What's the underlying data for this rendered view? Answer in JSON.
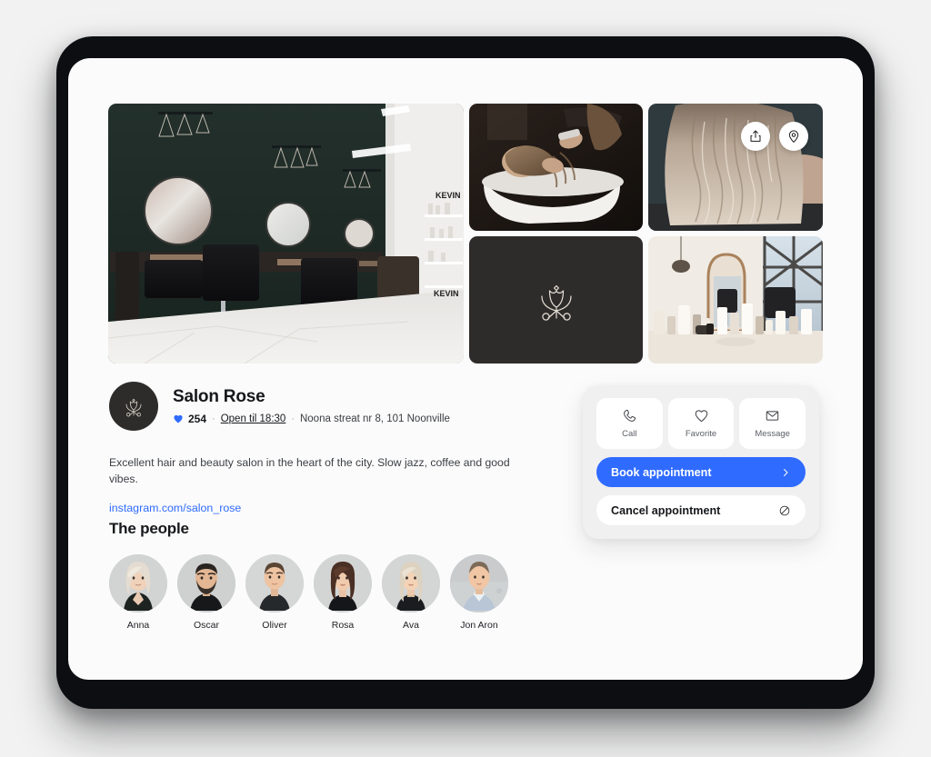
{
  "gallery": {
    "tiles": [
      {
        "name": "salon-interior-photo",
        "alt": "Salon interior with dark green wall, round mirrors and black styling chairs"
      },
      {
        "name": "hair-washing-photo",
        "alt": "Stylist washing client hair at basin"
      },
      {
        "name": "blonde-hair-photo",
        "alt": "Back of client with wavy blonde balayage hair"
      },
      {
        "name": "brand-logo-tile",
        "alt": "Salon Rose tulip and scissors logo on dark background"
      },
      {
        "name": "product-shelf-photo",
        "alt": "Styling products on counter with mirror and window"
      }
    ],
    "actions": [
      {
        "name": "share-button",
        "icon": "share-icon",
        "label": "Share"
      },
      {
        "name": "location-button",
        "icon": "location-pin-icon",
        "label": "Location"
      }
    ]
  },
  "profile": {
    "salon_name": "Salon Rose",
    "likes": "254",
    "separator": "·",
    "open_hours": "Open til 18:30",
    "address": "Noona streat nr 8, 101 Noonville",
    "description": "Excellent hair and beauty salon in the heart of the city. Slow jazz, coffee and good vibes.",
    "instagram": "instagram.com/salon_rose"
  },
  "people": {
    "title": "The people",
    "members": [
      {
        "name": "Anna"
      },
      {
        "name": "Oscar"
      },
      {
        "name": "Oliver"
      },
      {
        "name": "Rosa"
      },
      {
        "name": "Ava"
      },
      {
        "name": "Jon Aron"
      }
    ]
  },
  "action_card": {
    "quick_actions": [
      {
        "label": "Call",
        "icon": "phone-icon"
      },
      {
        "label": "Favorite",
        "icon": "heart-icon"
      },
      {
        "label": "Message",
        "icon": "envelope-icon"
      }
    ],
    "book_label": "Book appointment",
    "cancel_label": "Cancel appointment"
  },
  "colors": {
    "accent_blue": "#2f6bff",
    "brand_dark": "#2e2c2b",
    "logo_cream": "#e8e0d6",
    "card_bg": "#f0f0f1",
    "page_bg": "#fbfbfb",
    "frame": "#0c0e11"
  }
}
